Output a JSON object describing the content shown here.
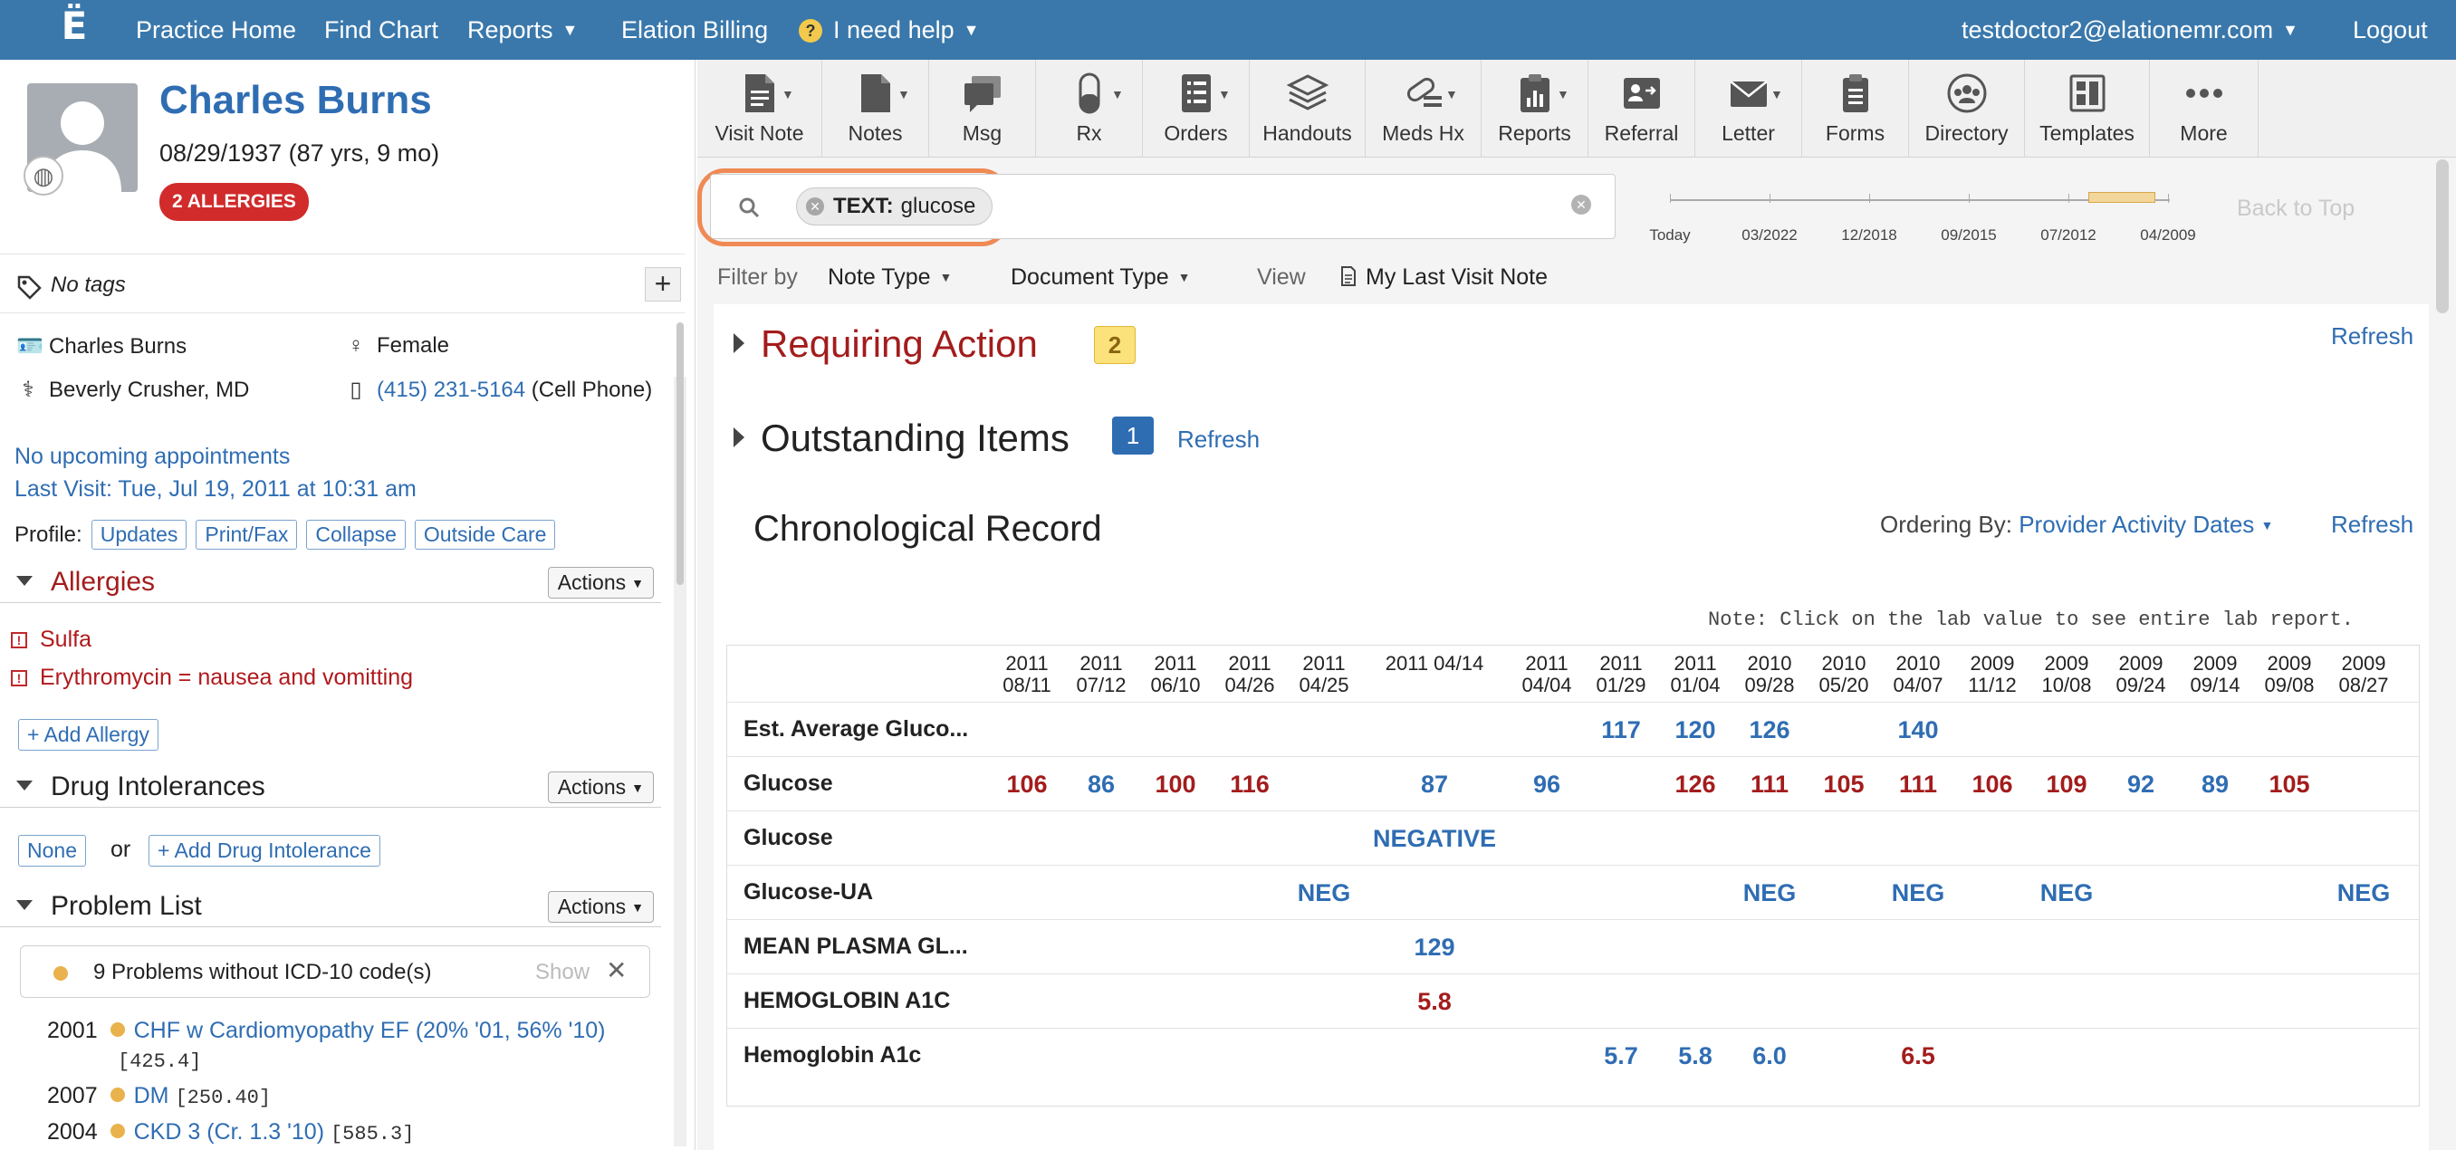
{
  "topnav": {
    "items": {
      "practice_home": "Practice Home",
      "find_chart": "Find Chart",
      "reports": "Reports",
      "billing": "Elation Billing",
      "help": "I need help"
    },
    "user_email": "testdoctor2@elationemr.com",
    "logout": "Logout"
  },
  "patient": {
    "name": "Charles Burns",
    "dob": "08/29/1937 (87 yrs, 9 mo)",
    "allergy_badge": "2 ALLERGIES",
    "tags": "No tags",
    "full_name": "Charles Burns",
    "gender": "Female",
    "provider": "Beverly Crusher, MD",
    "phone": "(415) 231-5164",
    "phone_type": "(Cell Phone)",
    "appointments": "No upcoming appointments",
    "last_visit": "Last Visit: Tue, Jul 19, 2011 at 10:31 am",
    "profile_label": "Profile:",
    "profile_buttons": [
      "Updates",
      "Print/Fax",
      "Collapse",
      "Outside Care"
    ]
  },
  "allergies": {
    "title": "Allergies",
    "actions": "Actions",
    "items": [
      "Sulfa",
      "Erythromycin = nausea and vomitting"
    ],
    "add": "+ Add Allergy"
  },
  "intolerances": {
    "title": "Drug Intolerances",
    "actions": "Actions",
    "none": "None",
    "or": "or",
    "add": "+ Add Drug Intolerance"
  },
  "problems": {
    "title": "Problem List",
    "actions": "Actions",
    "icd_notice": "9 Problems without ICD-10 code(s)",
    "icd_show": "Show",
    "items": [
      {
        "year": "2001",
        "label": "CHF w Cardiomyopathy EF (20% '01, 56% '10)",
        "code": "[425.4]"
      },
      {
        "year": "2007",
        "label": "DM",
        "code": "[250.40]"
      },
      {
        "year": "2004",
        "label": "CKD 3 (Cr. 1.3 '10)",
        "code": "[585.3]"
      }
    ]
  },
  "toolbar": [
    "Visit Note",
    "Notes",
    "Msg",
    "Rx",
    "Orders",
    "Handouts",
    "Meds Hx",
    "Reports",
    "Referral",
    "Letter",
    "Forms",
    "Directory",
    "Templates",
    "More"
  ],
  "search": {
    "chip_label": "TEXT:",
    "chip_value": "glucose"
  },
  "timeline": {
    "labels": [
      "Today",
      "03/2022",
      "12/2018",
      "09/2015",
      "07/2012",
      "04/2009"
    ],
    "back_to_top": "Back to Top"
  },
  "filters": {
    "filter_by": "Filter by",
    "note_type": "Note Type",
    "document_type": "Document Type",
    "view": "View",
    "last_visit_note": "My Last Visit Note"
  },
  "requiring_action": {
    "title": "Requiring Action",
    "count": "2",
    "refresh": "Refresh"
  },
  "outstanding": {
    "title": "Outstanding Items",
    "count": "1",
    "refresh": "Refresh"
  },
  "chronological": {
    "title": "Chronological Record",
    "ordering_label": "Ordering By:",
    "ordering_value": "Provider Activity Dates",
    "refresh": "Refresh",
    "note": "Note: Click on the lab value to see entire lab report."
  },
  "labs": {
    "dates": [
      [
        "2011",
        "08/11"
      ],
      [
        "2011",
        "07/12"
      ],
      [
        "2011",
        "06/10"
      ],
      [
        "2011",
        "04/26"
      ],
      [
        "2011",
        "04/25"
      ],
      [
        "2011 04/14",
        ""
      ],
      [
        "2011",
        "04/04"
      ],
      [
        "2011",
        "01/29"
      ],
      [
        "2011",
        "01/04"
      ],
      [
        "2010",
        "09/28"
      ],
      [
        "2010",
        "05/20"
      ],
      [
        "2010",
        "04/07"
      ],
      [
        "2009",
        "11/12"
      ],
      [
        "2009",
        "10/08"
      ],
      [
        "2009",
        "09/24"
      ],
      [
        "2009",
        "09/14"
      ],
      [
        "2009",
        "09/08"
      ],
      [
        "2009",
        "08/27"
      ]
    ],
    "rows": [
      {
        "name": "Est. Average Gluco...",
        "values": [
          {
            "col": 7,
            "v": "117",
            "flag": "n"
          },
          {
            "col": 8,
            "v": "120",
            "flag": "n"
          },
          {
            "col": 9,
            "v": "126",
            "flag": "n"
          },
          {
            "col": 11,
            "v": "140",
            "flag": "n"
          }
        ]
      },
      {
        "name": "Glucose",
        "values": [
          {
            "col": 0,
            "v": "106",
            "flag": "h"
          },
          {
            "col": 1,
            "v": "86",
            "flag": "n"
          },
          {
            "col": 2,
            "v": "100",
            "flag": "h"
          },
          {
            "col": 3,
            "v": "116",
            "flag": "h"
          },
          {
            "col": 5,
            "v": "87",
            "flag": "n"
          },
          {
            "col": 6,
            "v": "96",
            "flag": "n"
          },
          {
            "col": 8,
            "v": "126",
            "flag": "h"
          },
          {
            "col": 9,
            "v": "111",
            "flag": "h"
          },
          {
            "col": 10,
            "v": "105",
            "flag": "h"
          },
          {
            "col": 11,
            "v": "111",
            "flag": "h"
          },
          {
            "col": 12,
            "v": "106",
            "flag": "h"
          },
          {
            "col": 13,
            "v": "109",
            "flag": "h"
          },
          {
            "col": 14,
            "v": "92",
            "flag": "n"
          },
          {
            "col": 15,
            "v": "89",
            "flag": "n"
          },
          {
            "col": 16,
            "v": "105",
            "flag": "h"
          }
        ]
      },
      {
        "name": "Glucose",
        "values": [
          {
            "col": 5,
            "v": "NEGATIVE",
            "flag": "n"
          }
        ]
      },
      {
        "name": "Glucose-UA",
        "values": [
          {
            "col": 4,
            "v": "NEG",
            "flag": "n"
          },
          {
            "col": 9,
            "v": "NEG",
            "flag": "n"
          },
          {
            "col": 11,
            "v": "NEG",
            "flag": "n"
          },
          {
            "col": 13,
            "v": "NEG",
            "flag": "n"
          },
          {
            "col": 17,
            "v": "NEG",
            "flag": "n"
          }
        ]
      },
      {
        "name": "MEAN PLASMA GL...",
        "values": [
          {
            "col": 5,
            "v": "129",
            "flag": "n"
          }
        ]
      },
      {
        "name": "HEMOGLOBIN A1C",
        "values": [
          {
            "col": 5,
            "v": "5.8",
            "flag": "h"
          }
        ]
      },
      {
        "name": "Hemoglobin A1c",
        "values": [
          {
            "col": 7,
            "v": "5.7",
            "flag": "n"
          },
          {
            "col": 8,
            "v": "5.8",
            "flag": "n"
          },
          {
            "col": 9,
            "v": "6.0",
            "flag": "n"
          },
          {
            "col": 11,
            "v": "6.5",
            "flag": "h"
          }
        ]
      }
    ]
  }
}
